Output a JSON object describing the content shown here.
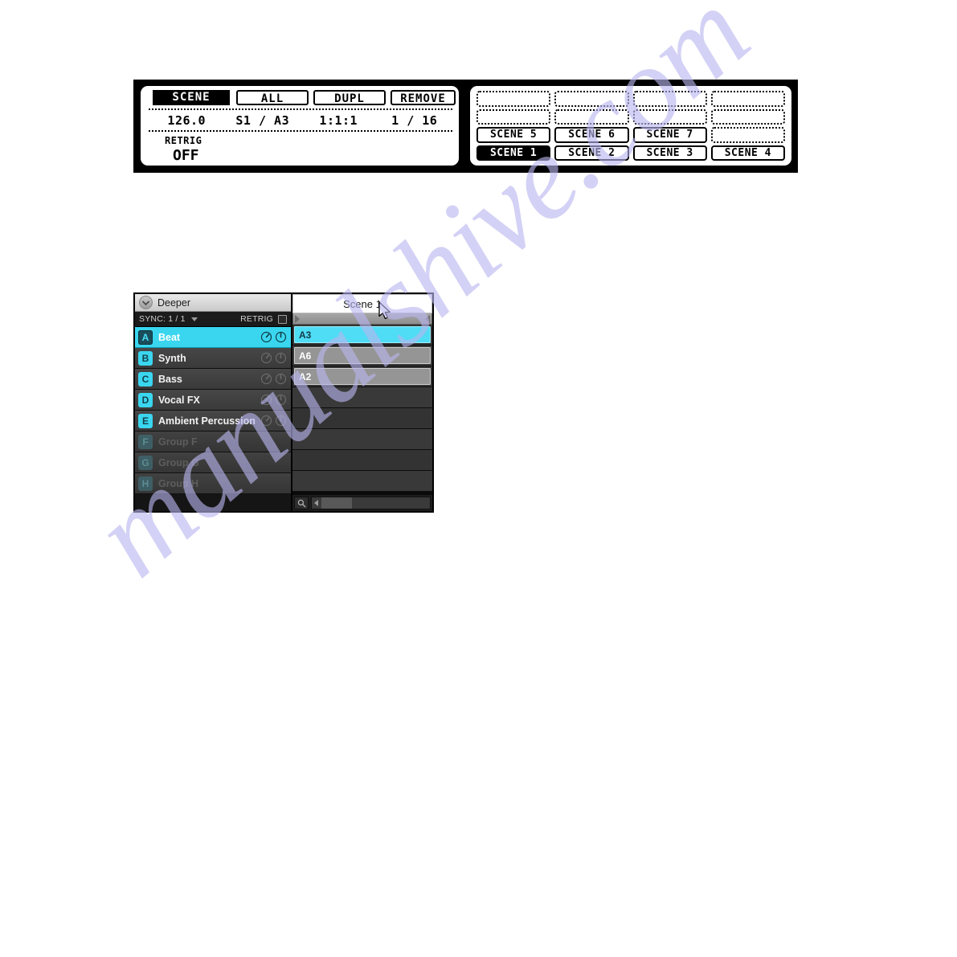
{
  "hardware": {
    "left_display": {
      "tabs": [
        {
          "label": "SCENE",
          "selected": true
        },
        {
          "label": "ALL",
          "selected": false
        },
        {
          "label": "DUPL",
          "selected": false
        },
        {
          "label": "REMOVE",
          "selected": false
        }
      ],
      "values": [
        "126.0",
        "S1 / A3",
        "1:1:1",
        "1 / 16"
      ],
      "retrig_label": "RETRIG",
      "retrig_value": "OFF"
    },
    "right_display": {
      "slots": [
        {
          "label": "",
          "state": "empty"
        },
        {
          "label": "",
          "state": "empty"
        },
        {
          "label": "",
          "state": "empty"
        },
        {
          "label": "",
          "state": "empty"
        },
        {
          "label": "",
          "state": "empty"
        },
        {
          "label": "",
          "state": "empty"
        },
        {
          "label": "",
          "state": "empty"
        },
        {
          "label": "",
          "state": "empty"
        },
        {
          "label": "SCENE 5",
          "state": "filled"
        },
        {
          "label": "SCENE 6",
          "state": "filled"
        },
        {
          "label": "SCENE 7",
          "state": "filled"
        },
        {
          "label": "",
          "state": "empty"
        },
        {
          "label": "SCENE 1",
          "state": "selected"
        },
        {
          "label": "SCENE 2",
          "state": "filled"
        },
        {
          "label": "SCENE 3",
          "state": "filled"
        },
        {
          "label": "SCENE 4",
          "state": "filled"
        }
      ]
    }
  },
  "software": {
    "header": {
      "title": "Deeper",
      "arrow_icon": "chevron-down-circle-icon"
    },
    "sync_bar": {
      "sync_label": "SYNC: 1 / 1",
      "retrig_label": "RETRIG",
      "retrig_checked": false
    },
    "groups": [
      {
        "letter": "A",
        "name": "Beat",
        "state": "active"
      },
      {
        "letter": "B",
        "name": "Synth",
        "state": "normal"
      },
      {
        "letter": "C",
        "name": "Bass",
        "state": "normal"
      },
      {
        "letter": "D",
        "name": "Vocal FX",
        "state": "normal"
      },
      {
        "letter": "E",
        "name": "Ambient Percussion",
        "state": "normal"
      },
      {
        "letter": "F",
        "name": "Group F",
        "state": "empty"
      },
      {
        "letter": "G",
        "name": "Group G",
        "state": "empty"
      },
      {
        "letter": "H",
        "name": "Group H",
        "state": "empty"
      }
    ],
    "scene_column": {
      "title": "Scene 1",
      "slots": [
        {
          "label": "A3",
          "state": "selected"
        },
        {
          "label": "A6",
          "state": "filled"
        },
        {
          "label": "A2",
          "state": "filled"
        },
        {
          "label": "",
          "state": "empty"
        },
        {
          "label": "",
          "state": "empty"
        },
        {
          "label": "",
          "state": "empty"
        },
        {
          "label": "",
          "state": "empty"
        },
        {
          "label": "",
          "state": "empty"
        }
      ]
    },
    "bottom_bar": {
      "search_icon": "magnifier-icon"
    }
  },
  "watermark": {
    "text": "manualshive.com"
  },
  "colors": {
    "accent_cyan": "#3ad6ef",
    "clip_selected": "#4fdcf5",
    "clip_filled": "#959595",
    "panel_black": "#000000",
    "watermark": "#b9b6ef"
  }
}
